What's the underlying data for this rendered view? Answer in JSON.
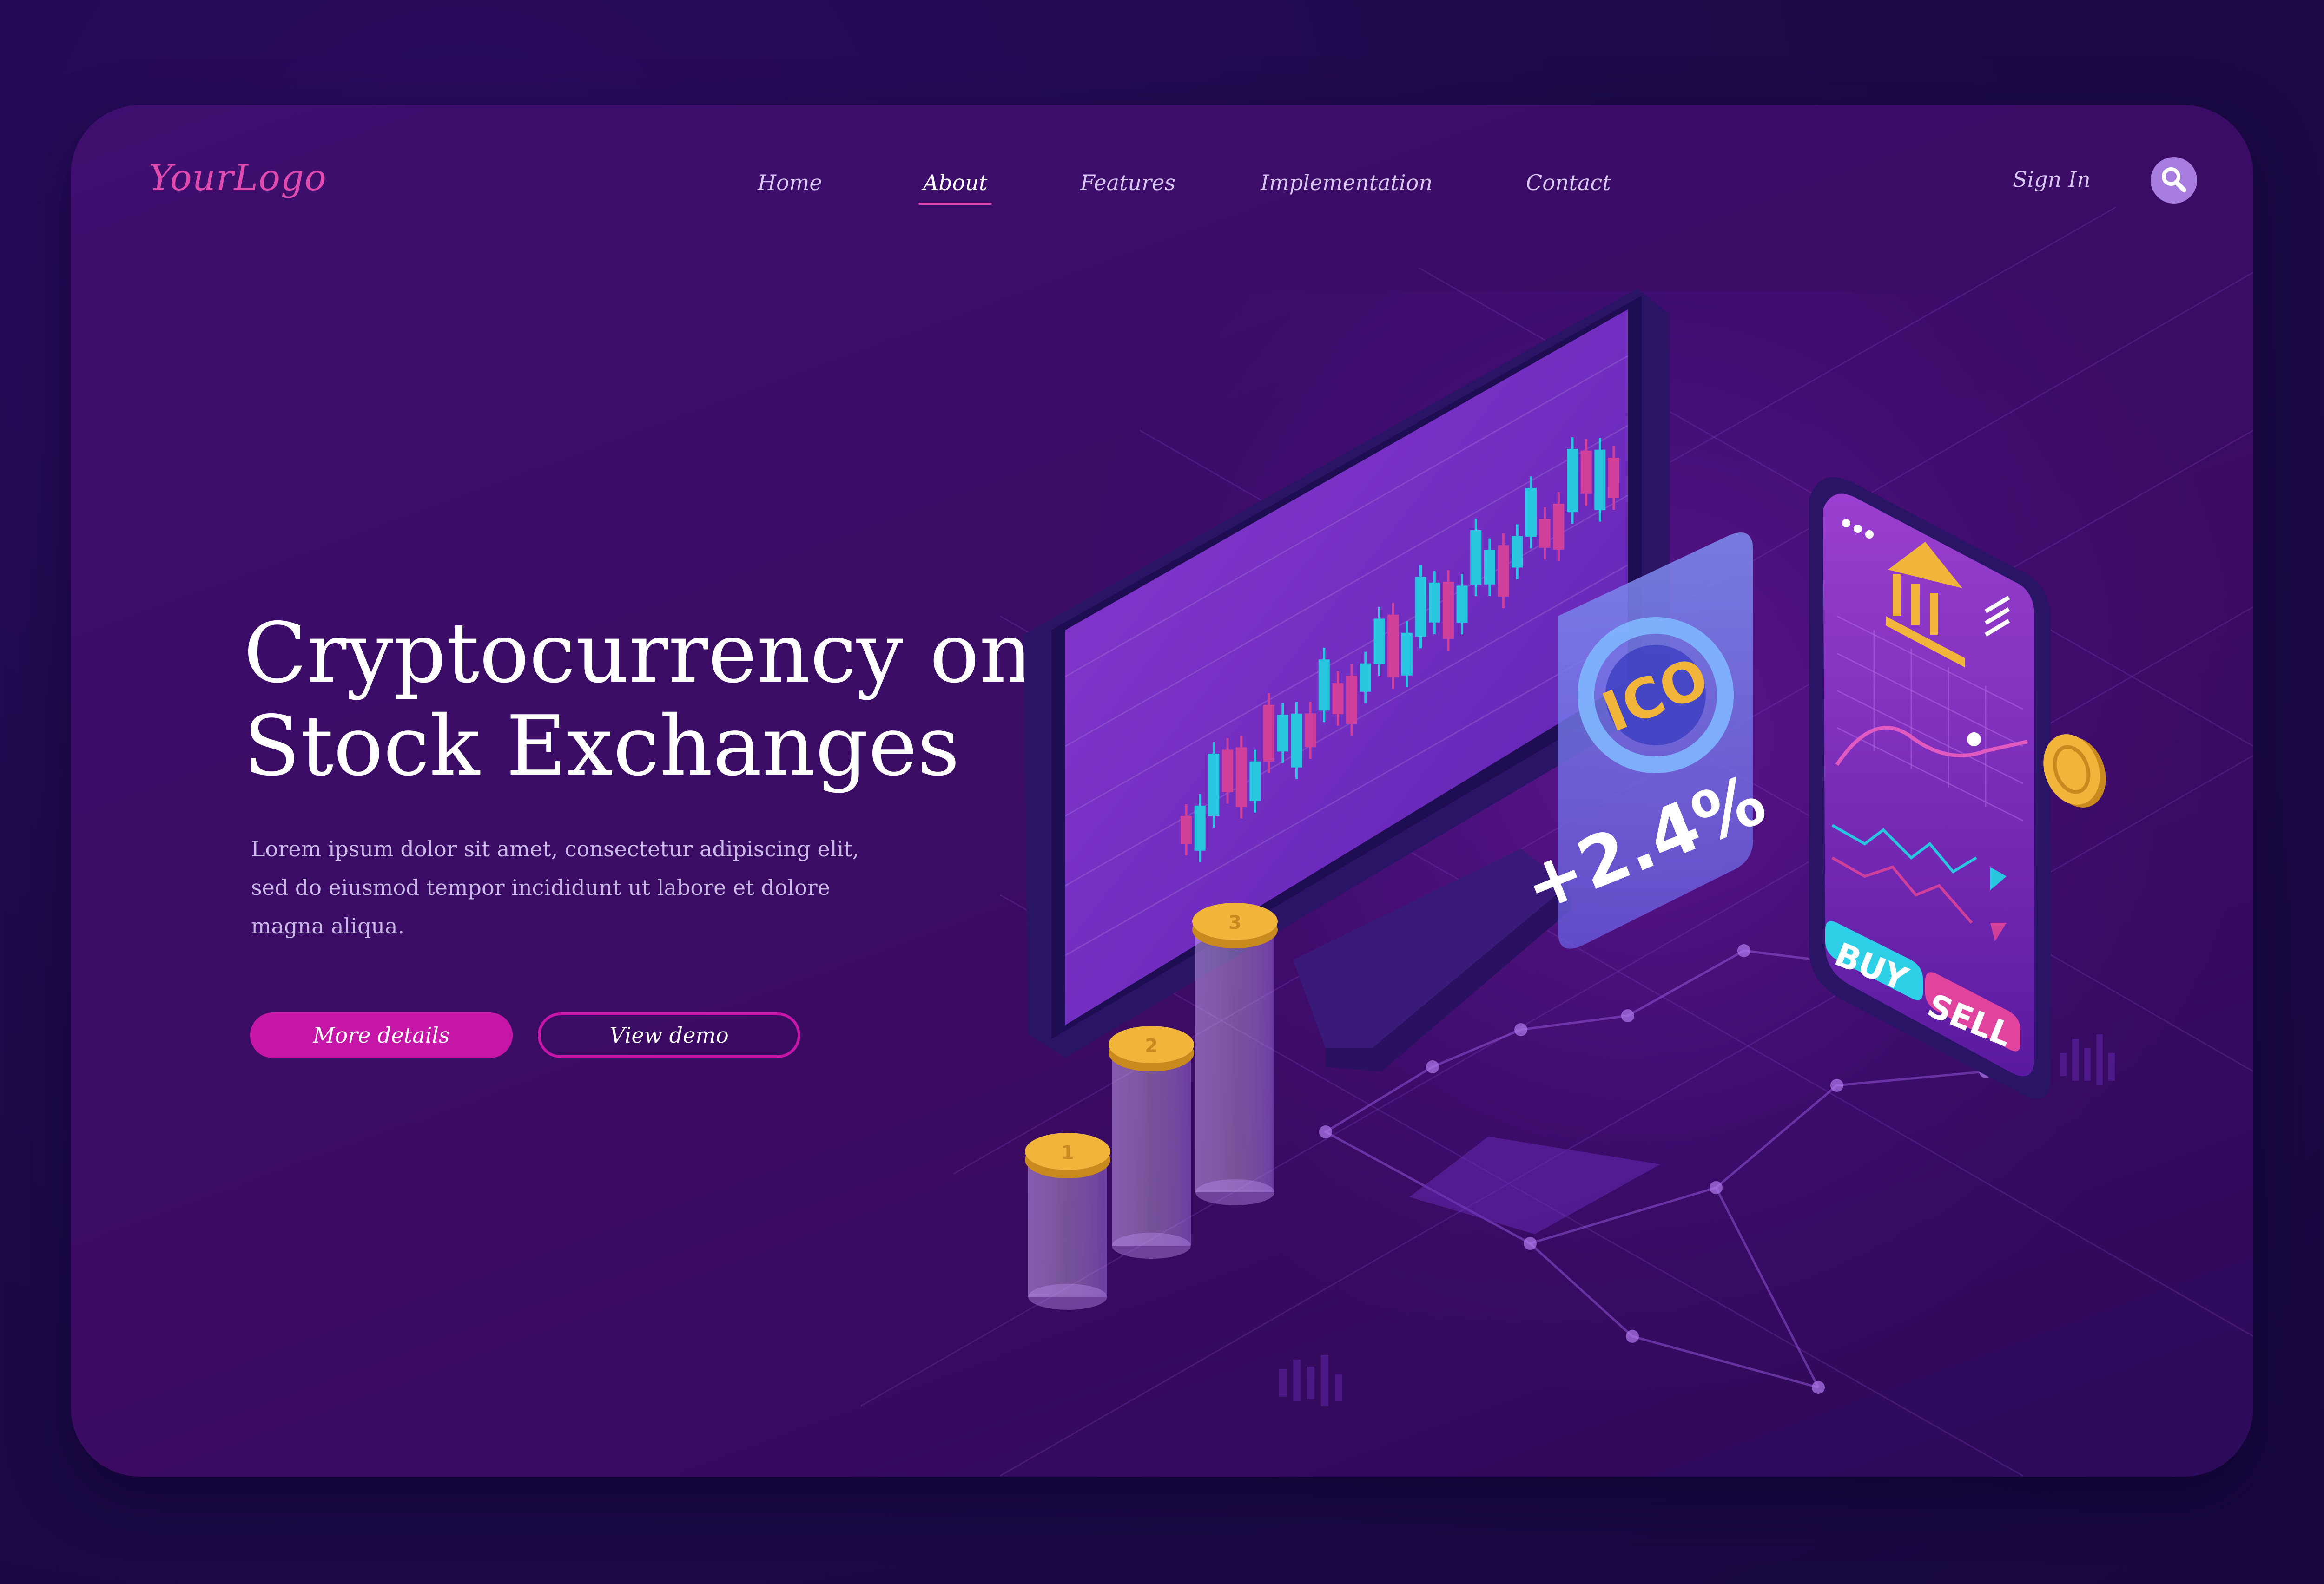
{
  "header": {
    "logo": "YourLogo",
    "nav": [
      {
        "label": "Home",
        "active": false
      },
      {
        "label": "About",
        "active": true
      },
      {
        "label": "Features",
        "active": false
      },
      {
        "label": "Implementation",
        "active": false
      },
      {
        "label": "Contact",
        "active": false
      }
    ],
    "sign_in": "Sign In",
    "search_icon": "search-icon"
  },
  "hero": {
    "title_line1": "Cryptocurrency on",
    "title_line2": "Stock Exchanges",
    "description": "Lorem ipsum dolor sit amet, consectetur adipiscing elit, sed do eiusmod tempor incididunt ut labore et dolore magna aliqua.",
    "primary_button": "More details",
    "secondary_button": "View demo"
  },
  "illustration": {
    "ico_badge": "ICO",
    "ico_change": "+2.4%",
    "phone_buy": "BUY",
    "phone_sell": "SELL",
    "coin_labels": [
      "1",
      "2",
      "3"
    ]
  },
  "colors": {
    "accent": "#c516a7",
    "logo": "#e04bb0",
    "candle_up": "#29c6e0",
    "candle_down": "#d0409a",
    "coin": "#f2b53c"
  }
}
